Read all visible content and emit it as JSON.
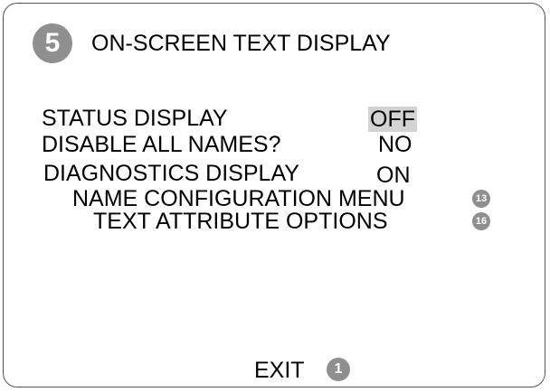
{
  "header": {
    "number": "5",
    "title": "ON-SCREEN TEXT DISPLAY"
  },
  "settings": [
    {
      "label": "STATUS DISPLAY",
      "value": "OFF",
      "selected": true
    },
    {
      "label": "DISABLE ALL NAMES?",
      "value": "NO",
      "selected": false
    },
    {
      "label": "DIAGNOSTICS DISPLAY",
      "value": "ON",
      "selected": false
    }
  ],
  "submenus": [
    {
      "label": "NAME CONFIGURATION MENU",
      "badge": "13"
    },
    {
      "label": "TEXT ATTRIBUTE OPTIONS",
      "badge": "16"
    }
  ],
  "exit": {
    "label": "EXIT",
    "badge": "1"
  },
  "colors": {
    "badge": "#8f8f8f",
    "selection_highlight": "#d3d3d3",
    "text": "#000000",
    "background": "#ffffff"
  }
}
